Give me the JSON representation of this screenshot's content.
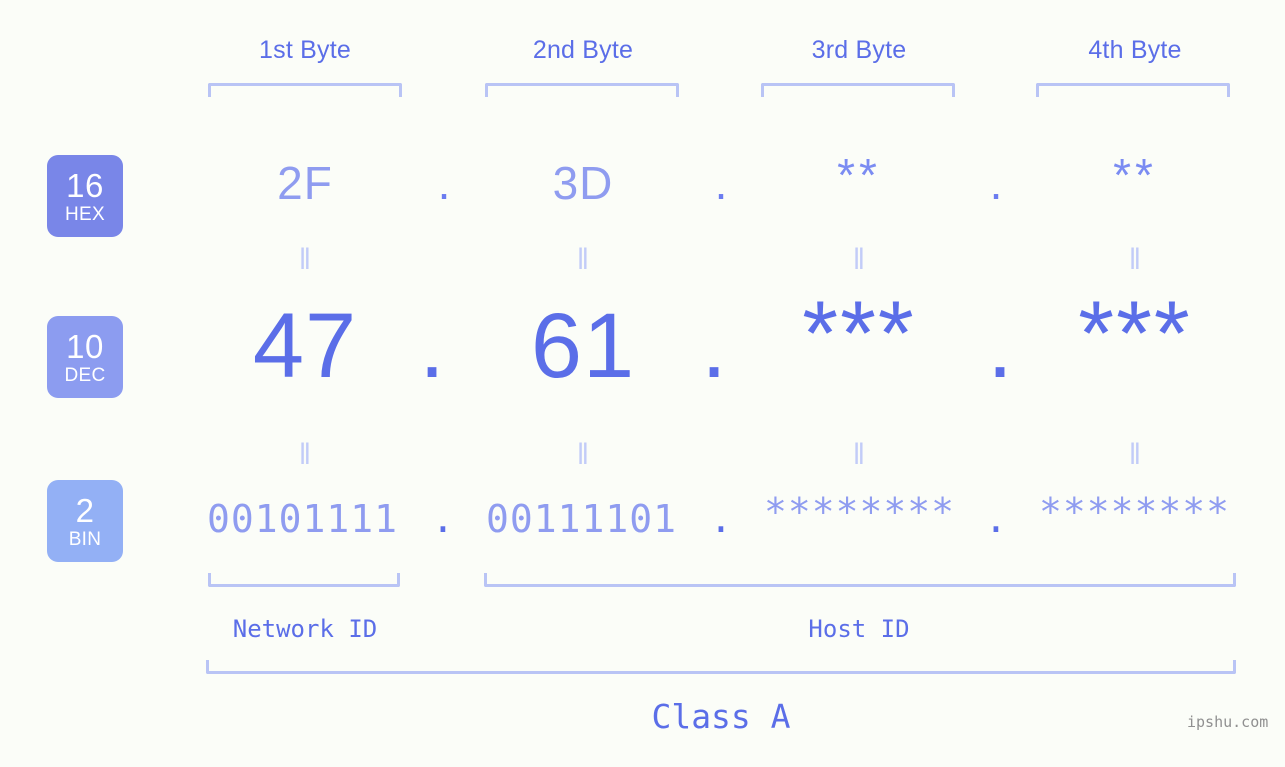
{
  "watermark": "ipshu.com",
  "colors": {
    "background": "#fbfdf8",
    "accent_strong": "#5b6ee8",
    "accent_mid": "#8f9cf0",
    "accent_light": "#b9c4f5",
    "connector": "#c2ccf8",
    "badge_hex": "#7986e8",
    "badge_dec": "#8c9cf0",
    "badge_bin": "#93b0f5",
    "watermark": "#909090"
  },
  "byte_headers": [
    {
      "label": "1st Byte"
    },
    {
      "label": "2nd Byte"
    },
    {
      "label": "3rd Byte"
    },
    {
      "label": "4th Byte"
    }
  ],
  "rows": [
    {
      "id": "hex",
      "badge_number": "16",
      "badge_name": "HEX",
      "values": [
        "2F",
        "3D",
        "**",
        "**"
      ],
      "separator": "."
    },
    {
      "id": "dec",
      "badge_number": "10",
      "badge_name": "DEC",
      "values": [
        "47",
        "61",
        "***",
        "***"
      ],
      "separator": "."
    },
    {
      "id": "bin",
      "badge_number": "2",
      "badge_name": "BIN",
      "values": [
        "00101111",
        "00111101",
        "********",
        "********"
      ],
      "separator": "."
    }
  ],
  "connectors": {
    "symbol": "‖"
  },
  "segments": {
    "network_id": "Network ID",
    "host_id": "Host ID",
    "class": "Class A"
  }
}
